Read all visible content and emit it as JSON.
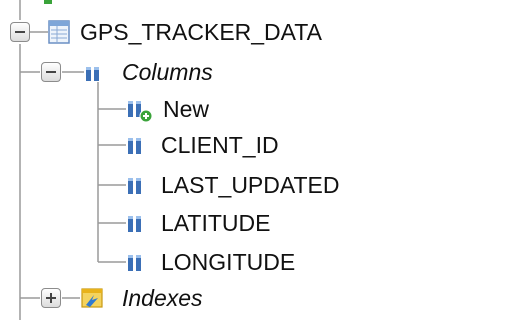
{
  "tree": {
    "table": {
      "label": "GPS_TRACKER_DATA",
      "icon": "table-icon",
      "expanded": true
    },
    "columns_group": {
      "label": "Columns",
      "icon": "columns-icon",
      "expanded": true
    },
    "columns": [
      {
        "label": "New",
        "icon": "new-column-icon"
      },
      {
        "label": "CLIENT_ID",
        "icon": "column-icon"
      },
      {
        "label": "LAST_UPDATED",
        "icon": "column-icon"
      },
      {
        "label": "LATITUDE",
        "icon": "column-icon"
      },
      {
        "label": "LONGITUDE",
        "icon": "column-icon"
      }
    ],
    "indexes_group": {
      "label": "Indexes",
      "icon": "indexes-icon",
      "expanded": false
    }
  },
  "colors": {
    "tree_line": "#9a9a9a",
    "column_blue": "#3b6fb6",
    "new_green": "#3aa33a",
    "index_yellow": "#e8b21a"
  }
}
